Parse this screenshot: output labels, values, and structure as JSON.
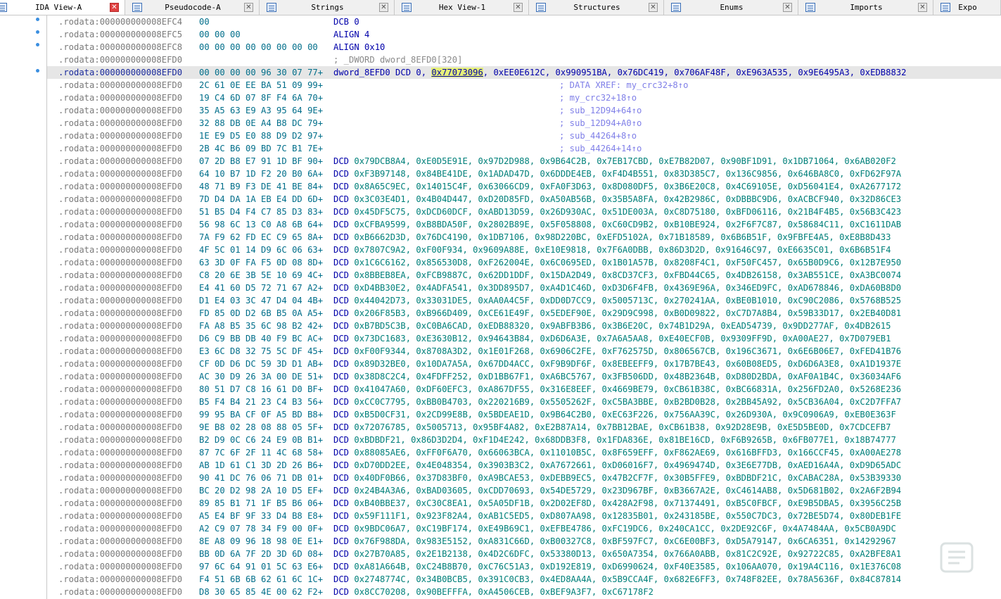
{
  "tabs": [
    {
      "label": "IDA View-A",
      "icon": "disassembly-icon",
      "active": true
    },
    {
      "label": "Pseudocode-A",
      "icon": "pseudocode-icon",
      "active": false
    },
    {
      "label": "Strings",
      "icon": "strings-icon",
      "active": false
    },
    {
      "label": "Hex View-1",
      "icon": "hex-icon",
      "active": false
    },
    {
      "label": "Structures",
      "icon": "structures-icon",
      "active": false
    },
    {
      "label": "Enums",
      "icon": "enums-icon",
      "active": false
    },
    {
      "label": "Imports",
      "icon": "imports-icon",
      "active": false
    },
    {
      "label": "Expo",
      "icon": "exports-icon",
      "active": false
    }
  ],
  "close_glyph": "✕",
  "lines": [
    {
      "addr": ".rodata:000000000008EFC4",
      "bytes": "00",
      "instr": "DCB 0"
    },
    {
      "addr": ".rodata:000000000008EFC5",
      "bytes": "00 00 00",
      "instr": "ALIGN 4"
    },
    {
      "addr": ".rodata:000000000008EFC8",
      "bytes": "00 00 00 00 00 00 00 00",
      "instr": "ALIGN 0x10"
    },
    {
      "addr": ".rodata:000000000008EFD0",
      "bytes": "",
      "comment": "; _DWORD dword_8EFD0[320]"
    },
    {
      "addr": ".rodata:000000000008EFD0",
      "bytes": "00 00 00 00 96 30 07 77+",
      "selected": true,
      "pre": "dword_8EFD0 DCD 0, ",
      "hl": "0x77073096",
      "post": ", 0xEE0E612C, 0x990951BA, 0x76DC419, 0x706AF48F, 0xE963A535, 0x9E6495A3, 0xEDB8832"
    },
    {
      "addr": ".rodata:000000000008EFD0",
      "bytes": "2C 61 0E EE BA 51 09 99+",
      "comment": "; DATA XREF: my_crc32+8↑o"
    },
    {
      "addr": ".rodata:000000000008EFD0",
      "bytes": "19 C4 6D 07 8F F4 6A 70+",
      "comment": "; my_crc32+18↑o"
    },
    {
      "addr": ".rodata:000000000008EFD0",
      "bytes": "35 A5 63 E9 A3 95 64 9E+",
      "comment": "; sub_12D94+64↑o"
    },
    {
      "addr": ".rodata:000000000008EFD0",
      "bytes": "32 88 DB 0E A4 B8 DC 79+",
      "comment": "; sub_12D94+A0↑o"
    },
    {
      "addr": ".rodata:000000000008EFD0",
      "bytes": "1E E9 D5 E0 88 D9 D2 97+",
      "comment": "; sub_44264+8↑o"
    },
    {
      "addr": ".rodata:000000000008EFD0",
      "bytes": "2B 4C B6 09 BD 7C B1 7E+",
      "comment": "; sub_44264+14↑o"
    },
    {
      "addr": ".rodata:000000000008EFD0",
      "bytes": "07 2D B8 E7 91 1D BF 90+",
      "dcd": "0x79DCB8A4, 0xE0D5E91E, 0x97D2D988, 0x9B64C2B, 0x7EB17CBD, 0xE7B82D07, 0x90BF1D91, 0x1DB71064, 0x6AB020F2"
    },
    {
      "addr": ".rodata:000000000008EFD0",
      "bytes": "64 10 B7 1D F2 20 B0 6A+",
      "dcd": "0xF3B97148, 0x84BE41DE, 0x1ADAD47D, 0x6DDDE4EB, 0xF4D4B551, 0x83D385C7, 0x136C9856, 0x646BA8C0, 0xFD62F97A"
    },
    {
      "addr": ".rodata:000000000008EFD0",
      "bytes": "48 71 B9 F3 DE 41 BE 84+",
      "dcd": "0x8A65C9EC, 0x14015C4F, 0x63066CD9, 0xFA0F3D63, 0x8D080DF5, 0x3B6E20C8, 0x4C69105E, 0xD56041E4, 0xA2677172"
    },
    {
      "addr": ".rodata:000000000008EFD0",
      "bytes": "7D D4 DA 1A EB E4 DD 6D+",
      "dcd": "0x3C03E4D1, 0x4B04D447, 0xD20D85FD, 0xA50AB56B, 0x35B5A8FA, 0x42B2986C, 0xDBBBC9D6, 0xACBCF940, 0x32D86CE3"
    },
    {
      "addr": ".rodata:000000000008EFD0",
      "bytes": "51 B5 D4 F4 C7 85 D3 83+",
      "dcd": "0x45DF5C75, 0xDCD60DCF, 0xABD13D59, 0x26D930AC, 0x51DE003A, 0xC8D75180, 0xBFD06116, 0x21B4F4B5, 0x56B3C423"
    },
    {
      "addr": ".rodata:000000000008EFD0",
      "bytes": "56 98 6C 13 C0 A8 6B 64+",
      "dcd": "0xCFBA9599, 0xB8BDA50F, 0x2802B89E, 0x5F058808, 0xC60CD9B2, 0xB10BE924, 0x2F6F7C87, 0x58684C11, 0xC1611DAB"
    },
    {
      "addr": ".rodata:000000000008EFD0",
      "bytes": "7A F9 62 FD EC C9 65 8A+",
      "dcd": "0xB6662D3D, 0x76DC4190, 0x1DB7106, 0x98D220BC, 0xEFD5102A, 0x71B18589, 0x6B6B51F, 0x9FBFE4A5, 0xE8B8D433"
    },
    {
      "addr": ".rodata:000000000008EFD0",
      "bytes": "4F 5C 01 14 D9 6C 06 63+",
      "dcd": "0x7807C9A2, 0xF00F934, 0x9609A88E, 0xE10E9818, 0x7F6A0DBB, 0x86D3D2D, 0x91646C97, 0xE6635C01, 0x6B6B51F4"
    },
    {
      "addr": ".rodata:000000000008EFD0",
      "bytes": "63 3D 0F FA F5 0D 08 8D+",
      "dcd": "0x1C6C6162, 0x856530D8, 0xF262004E, 0x6C0695ED, 0x1B01A57B, 0x8208F4C1, 0xF50FC457, 0x65B0D9C6, 0x12B7E950"
    },
    {
      "addr": ".rodata:000000000008EFD0",
      "bytes": "C8 20 6E 3B 5E 10 69 4C+",
      "dcd": "0x8BBEB8EA, 0xFCB9887C, 0x62DD1DDF, 0x15DA2D49, 0x8CD37CF3, 0xFBD44C65, 0x4DB26158, 0x3AB551CE, 0xA3BC0074"
    },
    {
      "addr": ".rodata:000000000008EFD0",
      "bytes": "E4 41 60 D5 72 71 67 A2+",
      "dcd": "0xD4BB30E2, 0x4ADFA541, 0x3DD895D7, 0xA4D1C46D, 0xD3D6F4FB, 0x4369E96A, 0x346ED9FC, 0xAD678846, 0xDA60B8D0"
    },
    {
      "addr": ".rodata:000000000008EFD0",
      "bytes": "D1 E4 03 3C 47 D4 04 4B+",
      "dcd": "0x44042D73, 0x33031DE5, 0xAA0A4C5F, 0xDD0D7CC9, 0x5005713C, 0x270241AA, 0xBE0B1010, 0xC90C2086, 0x5768B525"
    },
    {
      "addr": ".rodata:000000000008EFD0",
      "bytes": "FD 85 0D D2 6B B5 0A A5+",
      "dcd": "0x206F85B3, 0xB966D409, 0xCE61E49F, 0x5EDEF90E, 0x29D9C998, 0xB0D09822, 0xC7D7A8B4, 0x59B33D17, 0x2EB40D81"
    },
    {
      "addr": ".rodata:000000000008EFD0",
      "bytes": "FA A8 B5 35 6C 98 B2 42+",
      "dcd": "0xB7BD5C3B, 0xC0BA6CAD, 0xEDB88320, 0x9ABFB3B6, 0x3B6E20C, 0x74B1D29A, 0xEAD54739, 0x9DD277AF, 0x4DB2615"
    },
    {
      "addr": ".rodata:000000000008EFD0",
      "bytes": "D6 C9 BB DB 40 F9 BC AC+",
      "dcd": "0x73DC1683, 0xE3630B12, 0x94643B84, 0xD6D6A3E, 0x7A6A5AA8, 0xE40ECF0B, 0x9309FF9D, 0xA00AE27, 0x7D079EB1"
    },
    {
      "addr": ".rodata:000000000008EFD0",
      "bytes": "E3 6C D8 32 75 5C DF 45+",
      "dcd": "0xF00F9344, 0x8708A3D2, 0x1E01F268, 0x6906C2FE, 0xF762575D, 0x806567CB, 0x196C3671, 0x6E6B06E7, 0xFED41B76"
    },
    {
      "addr": ".rodata:000000000008EFD0",
      "bytes": "CF 0D D6 DC 59 3D D1 AB+",
      "dcd": "0x89D32BE0, 0x10DA7A5A, 0x67DD4ACC, 0xF9B9DF6F, 0x8EBEEFF9, 0x17B7BE43, 0x60B08ED5, 0xD6D6A3E8, 0xA1D1937E"
    },
    {
      "addr": ".rodata:000000000008EFD0",
      "bytes": "AC 30 D9 26 3A 00 DE 51+",
      "dcd": "0x38D8C2C4, 0x4FDFF252, 0xD1BB67F1, 0xA6BC5767, 0x3FB506DD, 0x48B2364B, 0xD80D2BDA, 0xAF0A1B4C, 0x36034AF6"
    },
    {
      "addr": ".rodata:000000000008EFD0",
      "bytes": "80 51 D7 C8 16 61 D0 BF+",
      "dcd": "0x41047A60, 0xDF60EFC3, 0xA867DF55, 0x316E8EEF, 0x4669BE79, 0xCB61B38C, 0xBC66831A, 0x256FD2A0, 0x5268E236"
    },
    {
      "addr": ".rodata:000000000008EFD0",
      "bytes": "B5 F4 B4 21 23 C4 B3 56+",
      "dcd": "0xCC0C7795, 0xBB0B4703, 0x220216B9, 0x5505262F, 0xC5BA3BBE, 0xB2BD0B28, 0x2BB45A92, 0x5CB36A04, 0xC2D7FFA7"
    },
    {
      "addr": ".rodata:000000000008EFD0",
      "bytes": "99 95 BA CF 0F A5 BD B8+",
      "dcd": "0xB5D0CF31, 0x2CD99E8B, 0x5BDEAE1D, 0x9B64C2B0, 0xEC63F226, 0x756AA39C, 0x26D930A, 0x9C0906A9, 0xEB0E363F"
    },
    {
      "addr": ".rodata:000000000008EFD0",
      "bytes": "9E B8 02 28 08 88 05 5F+",
      "dcd": "0x72076785, 0x5005713, 0x95BF4A82, 0xE2B87A14, 0x7BB12BAE, 0xCB61B38, 0x92D28E9B, 0xE5D5BE0D, 0x7CDCEFB7"
    },
    {
      "addr": ".rodata:000000000008EFD0",
      "bytes": "B2 D9 0C C6 24 E9 0B B1+",
      "dcd": "0xBDBDF21, 0x86D3D2D4, 0xF1D4E242, 0x68DDB3F8, 0x1FDA836E, 0x81BE16CD, 0xF6B9265B, 0x6FB077E1, 0x18B74777"
    },
    {
      "addr": ".rodata:000000000008EFD0",
      "bytes": "87 7C 6F 2F 11 4C 68 58+",
      "dcd": "0x88085AE6, 0xFF0F6A70, 0x66063BCA, 0x11010B5C, 0x8F659EFF, 0xF862AE69, 0x616BFFD3, 0x166CCF45, 0xA00AE278"
    },
    {
      "addr": ".rodata:000000000008EFD0",
      "bytes": "AB 1D 61 C1 3D 2D 26 B6+",
      "dcd": "0xD70DD2EE, 0x4E048354, 0x3903B3C2, 0xA7672661, 0xD06016F7, 0x4969474D, 0x3E6E77DB, 0xAED16A4A, 0xD9D65ADC"
    },
    {
      "addr": ".rodata:000000000008EFD0",
      "bytes": "90 41 DC 76 06 71 DB 01+",
      "dcd": "0x40DF0B66, 0x37D83BF0, 0xA9BCAE53, 0xDEBB9EC5, 0x47B2CF7F, 0x30B5FFE9, 0xBDBDF21C, 0xCABAC28A, 0x53B39330"
    },
    {
      "addr": ".rodata:000000000008EFD0",
      "bytes": "BC 20 D2 98 2A 10 D5 EF+",
      "dcd": "0x24B4A3A6, 0xBAD03605, 0xCDD70693, 0x54DE5729, 0x23D967BF, 0xB3667A2E, 0xC4614AB8, 0x5D681B02, 0x2A6F2B94"
    },
    {
      "addr": ".rodata:000000000008EFD0",
      "bytes": "89 85 B1 71 1F B5 B6 06+",
      "dcd": "0xB40BBE37, 0xC30C8EA1, 0x5A05DF1B, 0x2D02EF8D, 0x428A2F98, 0x71374491, 0xB5C0FBCF, 0xE9B5DBA5, 0x3956C25B"
    },
    {
      "addr": ".rodata:000000000008EFD0",
      "bytes": "A5 E4 BF 9F 33 D4 B8 E8+",
      "dcd": "0x59F111F1, 0x923F82A4, 0xAB1C5ED5, 0xD807AA98, 0x12835B01, 0x243185BE, 0x550C7DC3, 0x72BE5D74, 0x80DEB1FE"
    },
    {
      "addr": ".rodata:000000000008EFD0",
      "bytes": "A2 C9 07 78 34 F9 00 0F+",
      "dcd": "0x9BDC06A7, 0xC19BF174, 0xE49B69C1, 0xEFBE4786, 0xFC19DC6, 0x240CA1CC, 0x2DE92C6F, 0x4A7484AA, 0x5CB0A9DC"
    },
    {
      "addr": ".rodata:000000000008EFD0",
      "bytes": "8E A8 09 96 18 98 0E E1+",
      "dcd": "0x76F988DA, 0x983E5152, 0xA831C66D, 0xB00327C8, 0xBF597FC7, 0xC6E00BF3, 0xD5A79147, 0x6CA6351, 0x14292967"
    },
    {
      "addr": ".rodata:000000000008EFD0",
      "bytes": "BB 0D 6A 7F 2D 3D 6D 08+",
      "dcd": "0x27B70A85, 0x2E1B2138, 0x4D2C6DFC, 0x53380D13, 0x650A7354, 0x766A0ABB, 0x81C2C92E, 0x92722C85, 0xA2BFE8A1"
    },
    {
      "addr": ".rodata:000000000008EFD0",
      "bytes": "97 6C 64 91 01 5C 63 E6+",
      "dcd": "0xA81A664B, 0xC24B8B70, 0xC76C51A3, 0xD192E819, 0xD6990624, 0xF40E3585, 0x106AA070, 0x19A4C116, 0x1E376C08"
    },
    {
      "addr": ".rodata:000000000008EFD0",
      "bytes": "F4 51 6B 6B 62 61 6C 1C+",
      "dcd": "0x2748774C, 0x34B0BCB5, 0x391C0CB3, 0x4ED8AA4A, 0x5B9CCA4F, 0x682E6FF3, 0x748F82EE, 0x78A5636F, 0x84C87814"
    },
    {
      "addr": ".rodata:000000000008EFD0",
      "bytes": "D8 30 65 85 4E 00 62 F2+",
      "dcd": "0x8CC70208, 0x90BEFFFA, 0xA4506CEB, 0xBEF9A3F7, 0xC67178F2"
    }
  ]
}
